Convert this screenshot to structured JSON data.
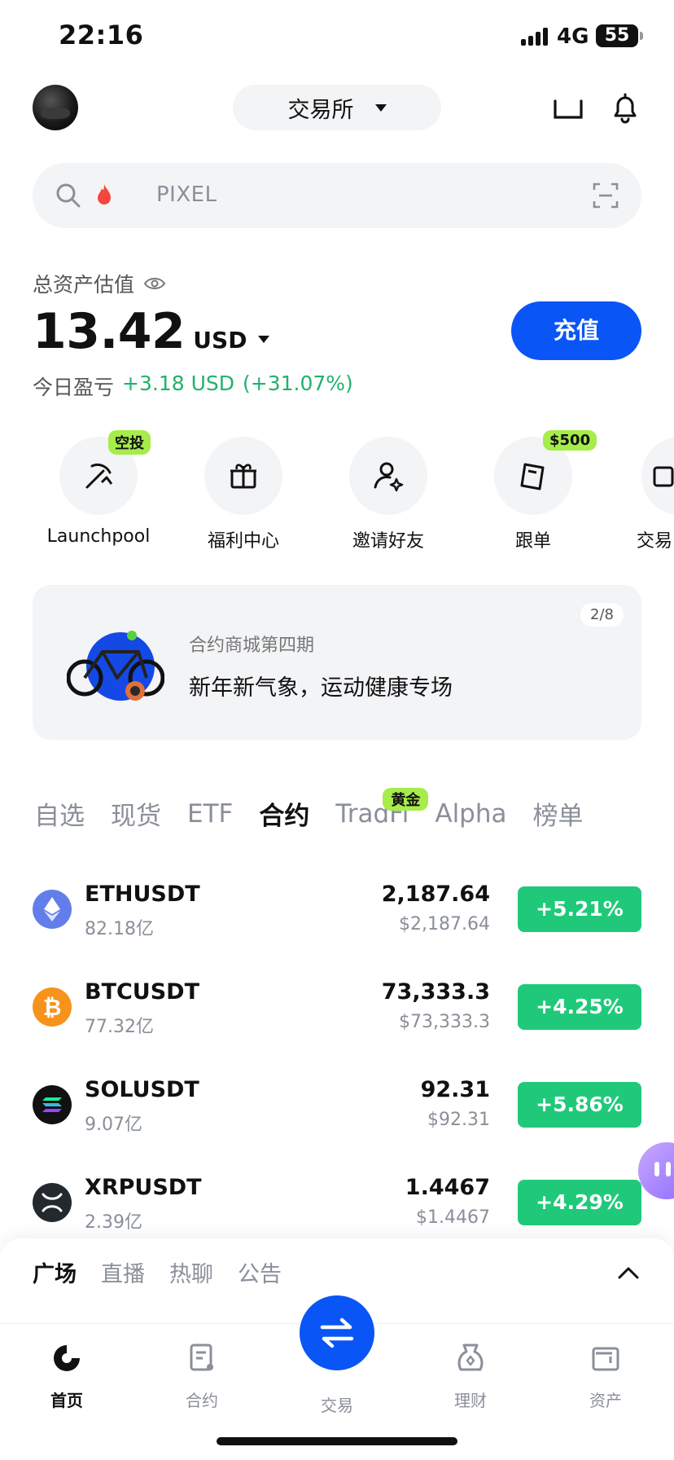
{
  "status_bar": {
    "time": "22:16",
    "network": "4G",
    "battery": "55"
  },
  "header": {
    "exchange_label": "交易所"
  },
  "search": {
    "placeholder": "PIXEL"
  },
  "assets": {
    "title": "总资产估值",
    "value": "13.42",
    "currency": "USD",
    "deposit_label": "充值",
    "pnl_label": "今日盈亏",
    "pnl_value": "+3.18 USD",
    "pnl_percent": "(+31.07%)"
  },
  "shortcuts": [
    {
      "label": "Launchpool",
      "tag": "空投",
      "icon": "pickaxe-icon"
    },
    {
      "label": "福利中心",
      "tag": "",
      "icon": "gift-icon"
    },
    {
      "label": "邀请好友",
      "tag": "",
      "icon": "invite-user-icon"
    },
    {
      "label": "跟单",
      "tag": "$500",
      "icon": "copy-trade-icon"
    },
    {
      "label": "交易",
      "tag": "",
      "icon": "trade-tool-icon"
    }
  ],
  "banner": {
    "page": "2/8",
    "subtitle": "合约商城第四期",
    "title": "新年新气象，运动健康专场"
  },
  "market_tabs": [
    {
      "label": "自选"
    },
    {
      "label": "现货"
    },
    {
      "label": "ETF"
    },
    {
      "label": "合约",
      "active": true
    },
    {
      "label": "TradFi",
      "badge": "黄金"
    },
    {
      "label": "Alpha"
    },
    {
      "label": "榜单"
    }
  ],
  "rows": [
    {
      "symbol": "ETHUSDT",
      "volume": "82.18亿",
      "price": "2,187.64",
      "fiat": "$2,187.64",
      "change": "+5.21%",
      "coin_color": "#627eea",
      "icon": "ethereum-icon"
    },
    {
      "symbol": "BTCUSDT",
      "volume": "77.32亿",
      "price": "73,333.3",
      "fiat": "$73,333.3",
      "change": "+4.25%",
      "coin_color": "#f7931a",
      "icon": "bitcoin-icon"
    },
    {
      "symbol": "SOLUSDT",
      "volume": "9.07亿",
      "price": "92.31",
      "fiat": "$92.31",
      "change": "+5.86%",
      "coin_color": "#111111",
      "icon": "solana-icon"
    },
    {
      "symbol": "XRPUSDT",
      "volume": "2.39亿",
      "price": "1.4467",
      "fiat": "$1.4467",
      "change": "+4.29%",
      "coin_color": "#23292f",
      "icon": "xrp-icon"
    }
  ],
  "community_tabs": [
    "广场",
    "直播",
    "热聊",
    "公告"
  ],
  "nav": [
    {
      "label": "首页",
      "icon": "home-icon"
    },
    {
      "label": "合约",
      "icon": "contract-icon"
    },
    {
      "label": "交易",
      "icon": "swap-icon"
    },
    {
      "label": "理财",
      "icon": "earn-icon"
    },
    {
      "label": "资产",
      "icon": "wallet-icon"
    }
  ],
  "colors": {
    "accent": "#0a55f5",
    "up": "#20c97a",
    "badge": "#a6ec4a"
  }
}
